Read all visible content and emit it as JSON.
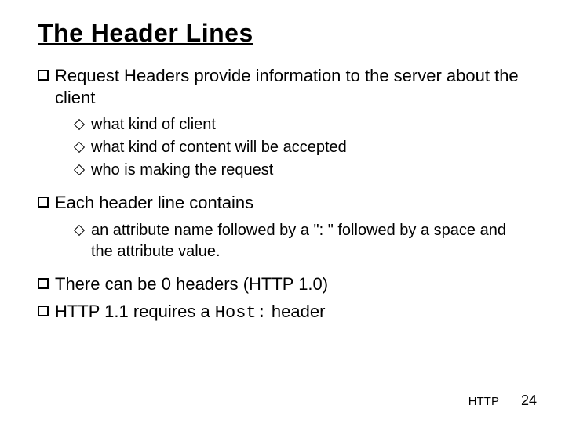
{
  "title": "The Header Lines",
  "bullets": [
    {
      "text": "Request Headers provide information to the server about the client",
      "sub": [
        "what kind of client",
        "what kind of content will be accepted",
        "who is making the request"
      ]
    },
    {
      "text": "Each header line contains",
      "sub": [
        "an attribute name followed by a \": \" followed by a space and the attribute value."
      ]
    },
    {
      "text": "There can be 0 headers (HTTP 1.0)",
      "sub": []
    },
    {
      "text_pre": "HTTP 1.1 requires a ",
      "code": "Host:",
      "text_post": " header",
      "sub": []
    }
  ],
  "footer": {
    "label": "HTTP",
    "page": "24"
  }
}
